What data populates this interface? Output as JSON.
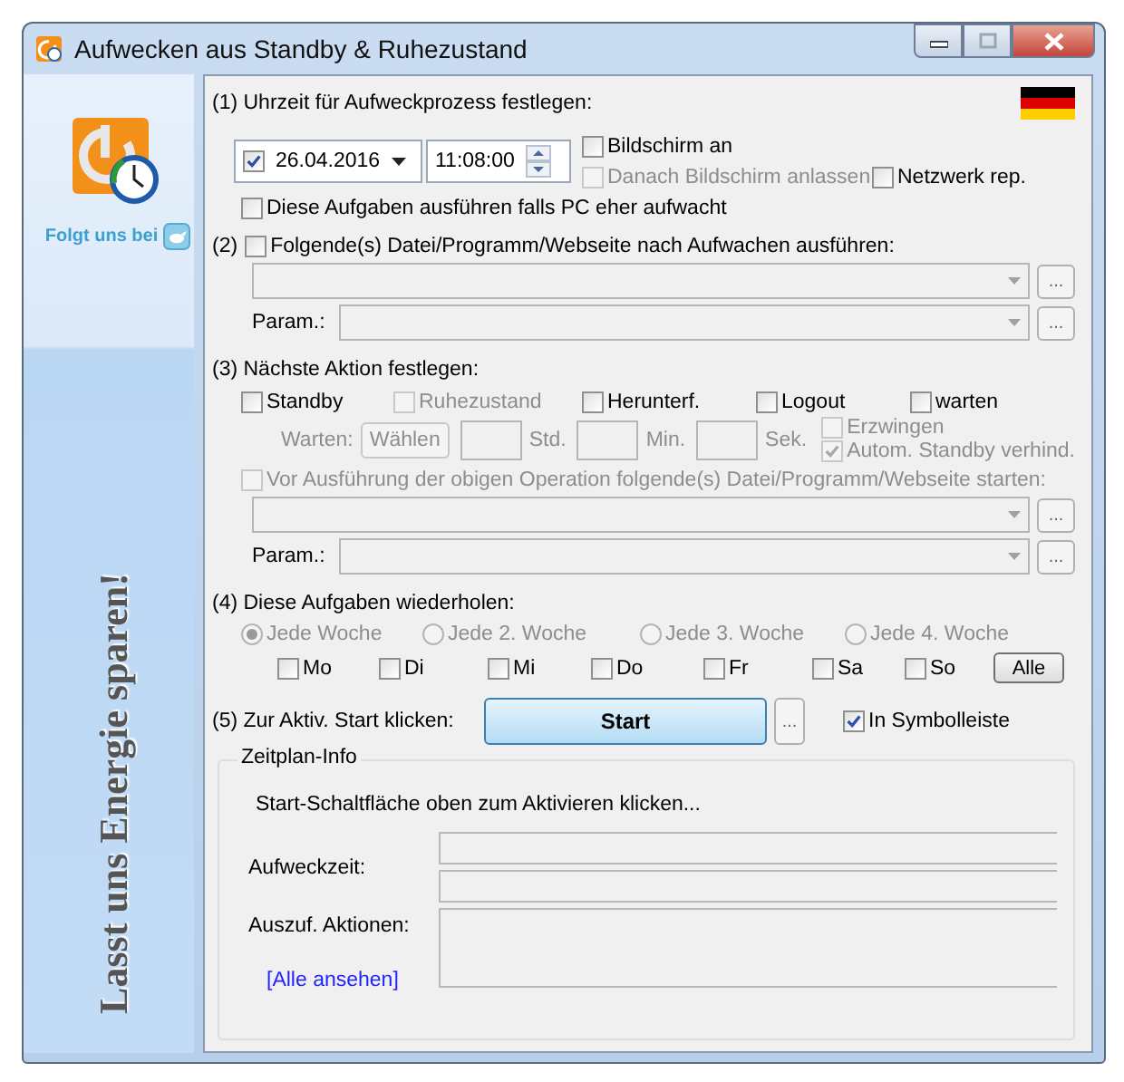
{
  "window": {
    "title": "Aufwecken aus Standby & Ruhezustand"
  },
  "sidebar": {
    "follow_label": "Folgt uns bei",
    "slogan": "Lasst uns Energie sparen!"
  },
  "section1": {
    "heading": "(1) Uhrzeit für Aufweckprozess festlegen:",
    "date": {
      "checked": true,
      "value": "26.04.2016"
    },
    "time": "11:08:00",
    "screen_on": {
      "label": "Bildschirm an",
      "checked": false,
      "disabled": false
    },
    "keep_screen_on": {
      "label": "Danach Bildschirm anlassen",
      "checked": false,
      "disabled": true
    },
    "network_repair": {
      "label": "Netzwerk rep.",
      "checked": false,
      "disabled": false
    },
    "run_if_awake": {
      "label": "Diese Aufgaben ausführen falls PC eher aufwacht",
      "checked": false,
      "disabled": false
    }
  },
  "section2": {
    "number": "(2)",
    "run_program": {
      "label": "Folgende(s) Datei/Programm/Webseite nach Aufwachen ausführen:",
      "checked": false,
      "disabled": false
    },
    "browse_button": "...",
    "param_label": "Param.:",
    "param_button": "..."
  },
  "section3": {
    "heading": "(3) Nächste Aktion festlegen:",
    "actions": [
      {
        "label": "Standby",
        "checked": false,
        "disabled": false
      },
      {
        "label": "Ruhezustand",
        "checked": false,
        "disabled": true
      },
      {
        "label": "Herunterf.",
        "checked": false,
        "disabled": false
      },
      {
        "label": "Logout",
        "checked": false,
        "disabled": false
      },
      {
        "label": "warten",
        "checked": false,
        "disabled": false
      }
    ],
    "wait": {
      "disabled": true,
      "label": "Warten:",
      "choose_button": "Wählen",
      "units": [
        "Std.",
        "Min.",
        "Sek."
      ]
    },
    "force": {
      "label": "Erzwingen",
      "checked": false,
      "disabled": true
    },
    "prevent_standby": {
      "label": "Autom. Standby verhind.",
      "checked": true,
      "disabled": true
    },
    "pre_run": {
      "label": "Vor Ausführung der obigen Operation folgende(s) Datei/Programm/Webseite starten:",
      "checked": false,
      "disabled": true
    },
    "browse_button": "...",
    "param_label": "Param.:",
    "param_button": "..."
  },
  "section4": {
    "heading": "(4) Diese Aufgaben wiederholen:",
    "intervals": [
      {
        "label": "Jede Woche",
        "selected": true,
        "disabled": true
      },
      {
        "label": "Jede 2. Woche",
        "selected": false,
        "disabled": true
      },
      {
        "label": "Jede 3. Woche",
        "selected": false,
        "disabled": true
      },
      {
        "label": "Jede 4. Woche",
        "selected": false,
        "disabled": true
      }
    ],
    "days": [
      {
        "label": "Mo",
        "checked": false
      },
      {
        "label": "Di",
        "checked": false
      },
      {
        "label": "Mi",
        "checked": false
      },
      {
        "label": "Do",
        "checked": false
      },
      {
        "label": "Fr",
        "checked": false
      },
      {
        "label": "Sa",
        "checked": false
      },
      {
        "label": "So",
        "checked": false
      }
    ],
    "all_button": "Alle"
  },
  "section5": {
    "label": "(5) Zur Aktiv. Start klicken:",
    "start_button": "Start",
    "more_button": "...",
    "tray": {
      "label": "In Symbolleiste",
      "checked": true,
      "disabled": false
    }
  },
  "schedule_info": {
    "title": "Zeitplan-Info",
    "message": "Start-Schaltfläche oben zum Aktivieren klicken...",
    "wake_label": "Aufweckzeit:",
    "actions_label": "Auszuf. Aktionen:",
    "link": "[Alle ansehen]"
  }
}
